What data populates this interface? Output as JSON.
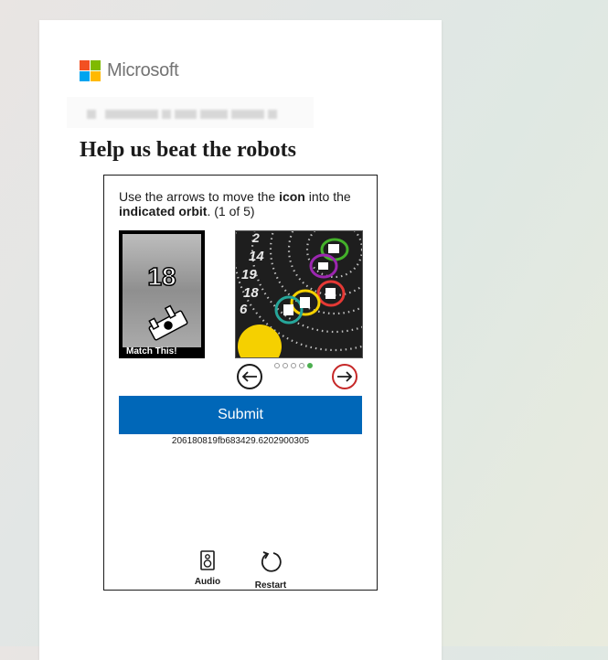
{
  "brand": {
    "name": "Microsoft",
    "colors": [
      "#f25022",
      "#7fba00",
      "#00a4ef",
      "#ffb900"
    ]
  },
  "heading": "Help us beat the robots",
  "challenge": {
    "instruction_prefix": "Use the arrows to move the ",
    "instruction_icon": "icon",
    "instruction_middle": " into the ",
    "instruction_orbit": "indicated orbit",
    "instruction_suffix": ". (1 of 5)",
    "match_label": "Match This!",
    "match_number": "18",
    "puzzle_numbers": [
      "2",
      "14",
      "19",
      "18",
      "6"
    ],
    "page_count": 5,
    "current_page": 5,
    "prev_icon": "arrow-left-icon",
    "next_icon": "arrow-right-icon"
  },
  "submit_label": "Submit",
  "session_id": "206180819fb683429.6202900305",
  "tools": {
    "audio_label": "Audio",
    "audio_icon": "speaker-icon",
    "restart_label": "Restart",
    "restart_icon": "restart-icon"
  },
  "colors": {
    "accent": "#0067b8",
    "next_arrow_border": "#c62828",
    "active_dot": "#4caf50"
  }
}
